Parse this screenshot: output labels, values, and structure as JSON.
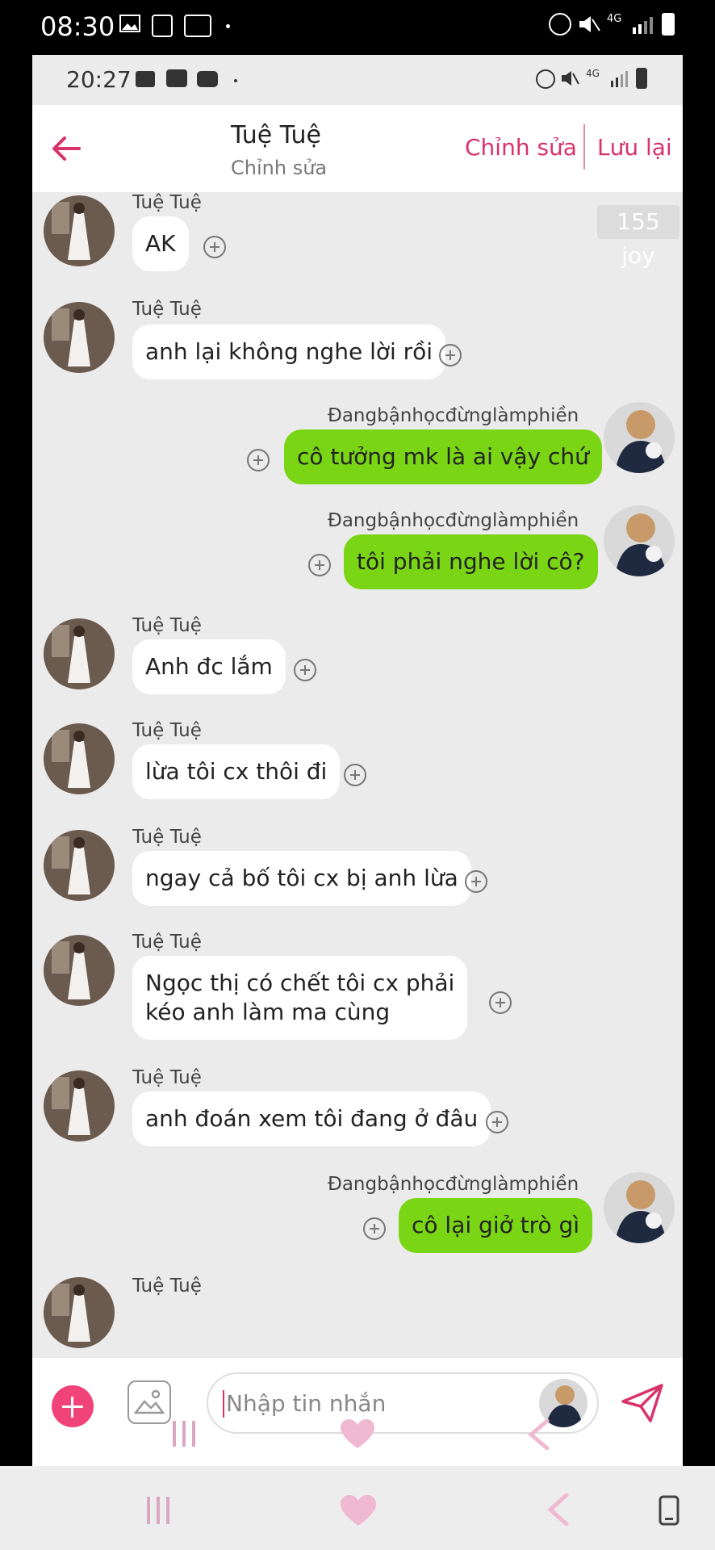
{
  "outer_status": {
    "time": "08:30",
    "network": "4G"
  },
  "inner_status": {
    "time": "20:27",
    "network": "4G"
  },
  "header": {
    "title": "Tuệ Tuệ",
    "subtitle": "Chỉnh sửa",
    "edit_label": "Chỉnh sửa",
    "save_label": "Lưu lại"
  },
  "badge": "155 joy",
  "messages": [
    {
      "direction": "in",
      "sender": "Tuệ Tuệ",
      "text": "AK"
    },
    {
      "direction": "in",
      "sender": "Tuệ Tuệ",
      "text": "anh lại không nghe lời rồi"
    },
    {
      "direction": "out",
      "sender": "Đangbậnhọcđừnglàmphiền",
      "text": "cô tưởng mk là ai vậy chứ"
    },
    {
      "direction": "out",
      "sender": "Đangbậnhọcđừnglàmphiền",
      "text": "tôi phải nghe lời cô?"
    },
    {
      "direction": "in",
      "sender": "Tuệ Tuệ",
      "text": "Anh đc lắm"
    },
    {
      "direction": "in",
      "sender": "Tuệ Tuệ",
      "text": "lừa tôi cx thôi đi"
    },
    {
      "direction": "in",
      "sender": "Tuệ Tuệ",
      "text": "ngay cả bố tôi cx bị anh lừa"
    },
    {
      "direction": "in",
      "sender": "Tuệ Tuệ",
      "text_line1": "Ngọc thị  có chết tôi cx phải",
      "text_line2": "kéo anh làm ma cùng"
    },
    {
      "direction": "in",
      "sender": "Tuệ Tuệ",
      "text": "anh đoán xem tôi đang ở đâu"
    },
    {
      "direction": "out",
      "sender": "Đangbậnhọcđừnglàmphiền",
      "text": "cô lại giở trò gì"
    },
    {
      "direction": "in",
      "sender": "Tuệ Tuệ"
    }
  ],
  "composer": {
    "placeholder": "Nhập tin nhắn"
  },
  "colors": {
    "accent": "#d8336b",
    "out_bubble": "#7ad614",
    "in_bubble": "#ffffff",
    "chat_bg": "#ebebeb"
  },
  "icons": [
    "back-arrow-icon",
    "plus-circle-icon",
    "image-icon",
    "send-icon",
    "recent-apps-icon",
    "home-heart-icon",
    "back-chevron-icon",
    "screenshot-icon"
  ]
}
